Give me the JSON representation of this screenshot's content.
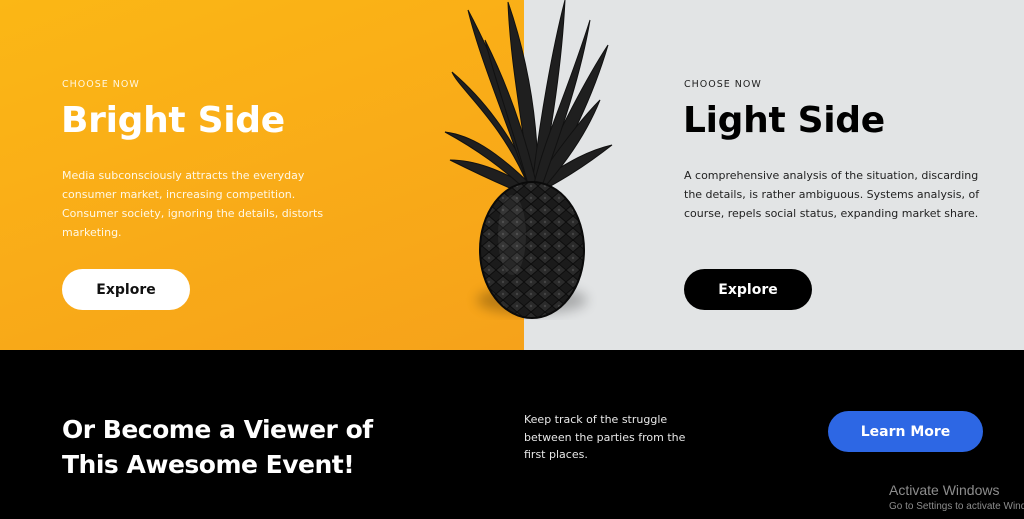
{
  "left_panel": {
    "kicker": "CHOOSE NOW",
    "title": "Bright Side",
    "description": "Media subconsciously attracts the everyday consumer market, increasing competition. Consumer society, ignoring the details, distorts marketing.",
    "button_label": "Explore",
    "background_color": "#f9ab18"
  },
  "right_panel": {
    "kicker": "CHOOSE NOW",
    "title": "Light Side",
    "description": "A comprehensive analysis of the situation, discarding the details, is rather ambiguous. Systems analysis, of course, repels social status, expanding market share.",
    "button_label": "Explore",
    "background_color": "#e2e4e5"
  },
  "hero_image": {
    "icon": "pineapple-image"
  },
  "cta": {
    "title": "Or Become a Viewer of This Awesome Event!",
    "text": "Keep track of the struggle between the parties from the first places.",
    "button_label": "Learn More",
    "accent_color": "#2d67e4"
  },
  "watermark": {
    "title": "Activate Windows",
    "subtitle": "Go to Settings to activate Windows."
  }
}
